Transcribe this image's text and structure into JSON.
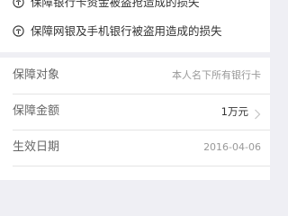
{
  "benefits": [
    {
      "text": "保障银行卡资金被盗抢造成的损失",
      "icon": "shield-icon"
    },
    {
      "text": "保障网银及手机银行被盗用造成的损失",
      "icon": "shield-icon"
    }
  ],
  "details": {
    "coverage_object": {
      "label": "保障对象",
      "value": "本人名下所有银行卡"
    },
    "coverage_amount": {
      "label": "保障金额",
      "value": "1万元"
    },
    "effective_date": {
      "label": "生效日期",
      "value": "2016-04-06"
    }
  },
  "colors": {
    "background": "#efeff4",
    "card": "#ffffff",
    "text_primary": "#333333",
    "text_label": "#666666",
    "text_muted": "#999999",
    "divider": "#e5e5e5"
  }
}
